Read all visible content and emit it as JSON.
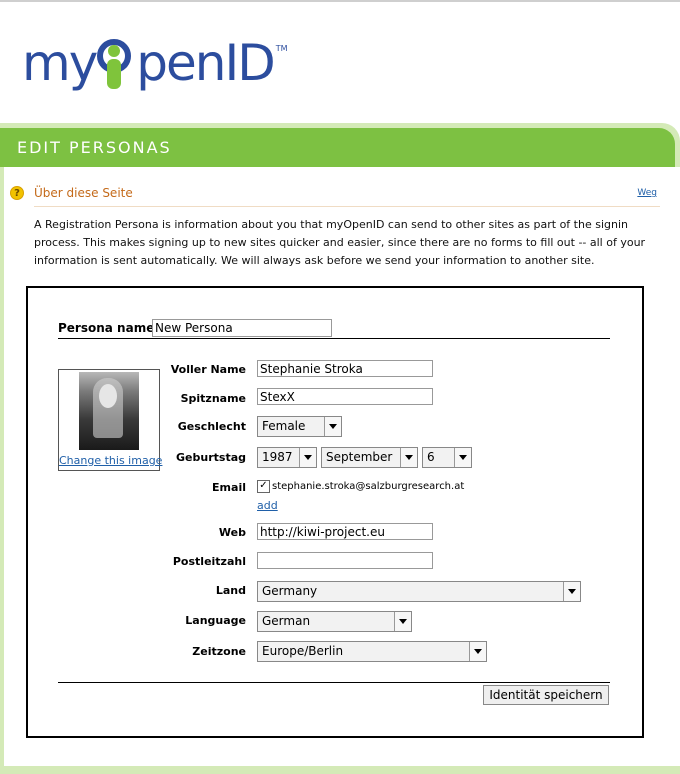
{
  "logo": {
    "my": "my",
    "open": "penID",
    "tm": "TM"
  },
  "banner": {
    "title": "EDIT PERSONAS"
  },
  "about": {
    "icon": "question-icon",
    "title": "Über diese Seite",
    "away": "Weg",
    "description": "A Registration Persona is information about you that myOpenID can send to other sites as part of the signin process. This makes signing up to new sites quicker and easier, since there are no forms to fill out -- all of your information is sent automatically. We will always ask before we send your information to another site."
  },
  "persona": {
    "name_label": "Persona name",
    "name_value": "New Persona",
    "photo_link": "Change this image",
    "fields": {
      "fullname_label": "Voller Name",
      "fullname_value": "Stephanie Stroka",
      "nickname_label": "Spitzname",
      "nickname_value": "StexX",
      "gender_label": "Geschlecht",
      "gender_value": "Female",
      "birthday_label": "Geburtstag",
      "birth_year": "1987",
      "birth_month": "September",
      "birth_day": "6",
      "email_label": "Email",
      "email_checked": "✓",
      "email_value": "stephanie.stroka@salzburgresearch.at",
      "email_add": "add",
      "web_label": "Web",
      "web_value": "http://kiwi-project.eu",
      "postcode_label": "Postleitzahl",
      "postcode_value": "",
      "country_label": "Land",
      "country_value": "Germany",
      "language_label": "Language",
      "language_value": "German",
      "timezone_label": "Zeitzone",
      "timezone_value": "Europe/Berlin"
    },
    "save_label": "Identität speichern"
  }
}
